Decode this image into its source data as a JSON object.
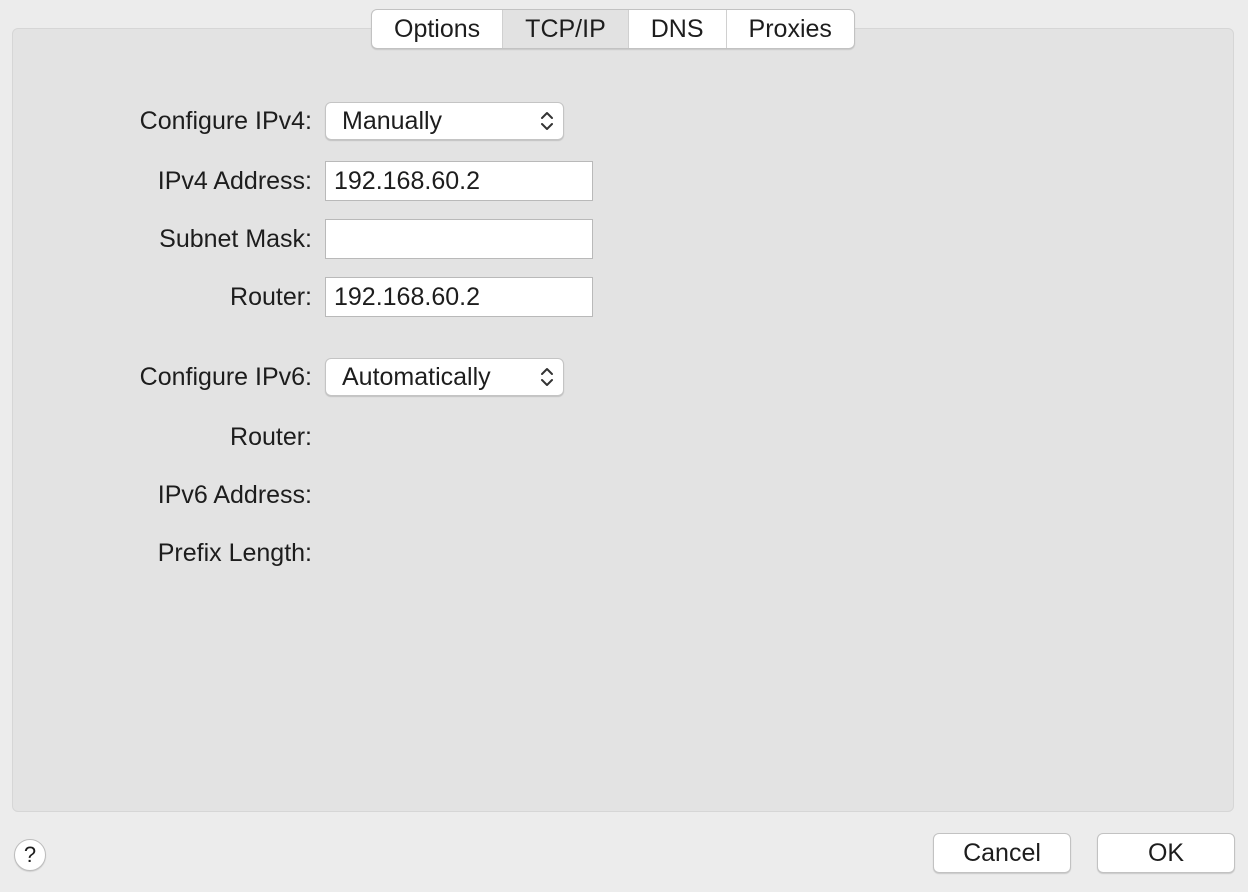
{
  "tabs": [
    {
      "label": "Options",
      "selected": false
    },
    {
      "label": "TCP/IP",
      "selected": true
    },
    {
      "label": "DNS",
      "selected": false
    },
    {
      "label": "Proxies",
      "selected": false
    }
  ],
  "ipv4": {
    "configure_label": "Configure IPv4:",
    "configure_value": "Manually",
    "address_label": "IPv4 Address:",
    "address_value": "192.168.60.2",
    "subnet_label": "Subnet Mask:",
    "subnet_value": "",
    "router_label": "Router:",
    "router_value": "192.168.60.2"
  },
  "ipv6": {
    "configure_label": "Configure IPv6:",
    "configure_value": "Automatically",
    "router_label": "Router:",
    "address_label": "IPv6 Address:",
    "prefix_label": "Prefix Length:"
  },
  "footer": {
    "help_label": "?",
    "cancel_label": "Cancel",
    "ok_label": "OK"
  },
  "icons": {
    "popup_arrows": "chevron-up-down-icon",
    "help": "question-mark-icon"
  }
}
